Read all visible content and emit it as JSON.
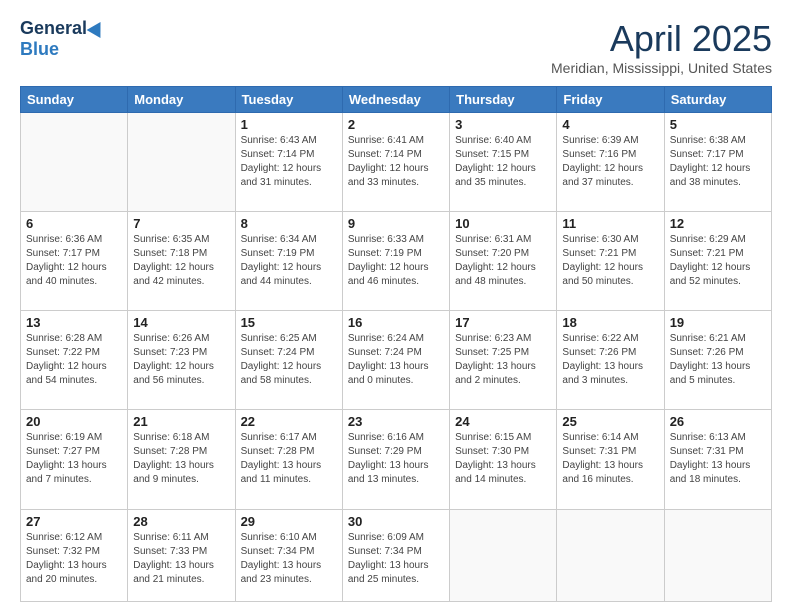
{
  "header": {
    "logo_general": "General",
    "logo_blue": "Blue",
    "title": "April 2025",
    "subtitle": "Meridian, Mississippi, United States"
  },
  "days_of_week": [
    "Sunday",
    "Monday",
    "Tuesday",
    "Wednesday",
    "Thursday",
    "Friday",
    "Saturday"
  ],
  "weeks": [
    [
      {
        "day": "",
        "info": ""
      },
      {
        "day": "",
        "info": ""
      },
      {
        "day": "1",
        "info": "Sunrise: 6:43 AM\nSunset: 7:14 PM\nDaylight: 12 hours and 31 minutes."
      },
      {
        "day": "2",
        "info": "Sunrise: 6:41 AM\nSunset: 7:14 PM\nDaylight: 12 hours and 33 minutes."
      },
      {
        "day": "3",
        "info": "Sunrise: 6:40 AM\nSunset: 7:15 PM\nDaylight: 12 hours and 35 minutes."
      },
      {
        "day": "4",
        "info": "Sunrise: 6:39 AM\nSunset: 7:16 PM\nDaylight: 12 hours and 37 minutes."
      },
      {
        "day": "5",
        "info": "Sunrise: 6:38 AM\nSunset: 7:17 PM\nDaylight: 12 hours and 38 minutes."
      }
    ],
    [
      {
        "day": "6",
        "info": "Sunrise: 6:36 AM\nSunset: 7:17 PM\nDaylight: 12 hours and 40 minutes."
      },
      {
        "day": "7",
        "info": "Sunrise: 6:35 AM\nSunset: 7:18 PM\nDaylight: 12 hours and 42 minutes."
      },
      {
        "day": "8",
        "info": "Sunrise: 6:34 AM\nSunset: 7:19 PM\nDaylight: 12 hours and 44 minutes."
      },
      {
        "day": "9",
        "info": "Sunrise: 6:33 AM\nSunset: 7:19 PM\nDaylight: 12 hours and 46 minutes."
      },
      {
        "day": "10",
        "info": "Sunrise: 6:31 AM\nSunset: 7:20 PM\nDaylight: 12 hours and 48 minutes."
      },
      {
        "day": "11",
        "info": "Sunrise: 6:30 AM\nSunset: 7:21 PM\nDaylight: 12 hours and 50 minutes."
      },
      {
        "day": "12",
        "info": "Sunrise: 6:29 AM\nSunset: 7:21 PM\nDaylight: 12 hours and 52 minutes."
      }
    ],
    [
      {
        "day": "13",
        "info": "Sunrise: 6:28 AM\nSunset: 7:22 PM\nDaylight: 12 hours and 54 minutes."
      },
      {
        "day": "14",
        "info": "Sunrise: 6:26 AM\nSunset: 7:23 PM\nDaylight: 12 hours and 56 minutes."
      },
      {
        "day": "15",
        "info": "Sunrise: 6:25 AM\nSunset: 7:24 PM\nDaylight: 12 hours and 58 minutes."
      },
      {
        "day": "16",
        "info": "Sunrise: 6:24 AM\nSunset: 7:24 PM\nDaylight: 13 hours and 0 minutes."
      },
      {
        "day": "17",
        "info": "Sunrise: 6:23 AM\nSunset: 7:25 PM\nDaylight: 13 hours and 2 minutes."
      },
      {
        "day": "18",
        "info": "Sunrise: 6:22 AM\nSunset: 7:26 PM\nDaylight: 13 hours and 3 minutes."
      },
      {
        "day": "19",
        "info": "Sunrise: 6:21 AM\nSunset: 7:26 PM\nDaylight: 13 hours and 5 minutes."
      }
    ],
    [
      {
        "day": "20",
        "info": "Sunrise: 6:19 AM\nSunset: 7:27 PM\nDaylight: 13 hours and 7 minutes."
      },
      {
        "day": "21",
        "info": "Sunrise: 6:18 AM\nSunset: 7:28 PM\nDaylight: 13 hours and 9 minutes."
      },
      {
        "day": "22",
        "info": "Sunrise: 6:17 AM\nSunset: 7:28 PM\nDaylight: 13 hours and 11 minutes."
      },
      {
        "day": "23",
        "info": "Sunrise: 6:16 AM\nSunset: 7:29 PM\nDaylight: 13 hours and 13 minutes."
      },
      {
        "day": "24",
        "info": "Sunrise: 6:15 AM\nSunset: 7:30 PM\nDaylight: 13 hours and 14 minutes."
      },
      {
        "day": "25",
        "info": "Sunrise: 6:14 AM\nSunset: 7:31 PM\nDaylight: 13 hours and 16 minutes."
      },
      {
        "day": "26",
        "info": "Sunrise: 6:13 AM\nSunset: 7:31 PM\nDaylight: 13 hours and 18 minutes."
      }
    ],
    [
      {
        "day": "27",
        "info": "Sunrise: 6:12 AM\nSunset: 7:32 PM\nDaylight: 13 hours and 20 minutes."
      },
      {
        "day": "28",
        "info": "Sunrise: 6:11 AM\nSunset: 7:33 PM\nDaylight: 13 hours and 21 minutes."
      },
      {
        "day": "29",
        "info": "Sunrise: 6:10 AM\nSunset: 7:34 PM\nDaylight: 13 hours and 23 minutes."
      },
      {
        "day": "30",
        "info": "Sunrise: 6:09 AM\nSunset: 7:34 PM\nDaylight: 13 hours and 25 minutes."
      },
      {
        "day": "",
        "info": ""
      },
      {
        "day": "",
        "info": ""
      },
      {
        "day": "",
        "info": ""
      }
    ]
  ]
}
